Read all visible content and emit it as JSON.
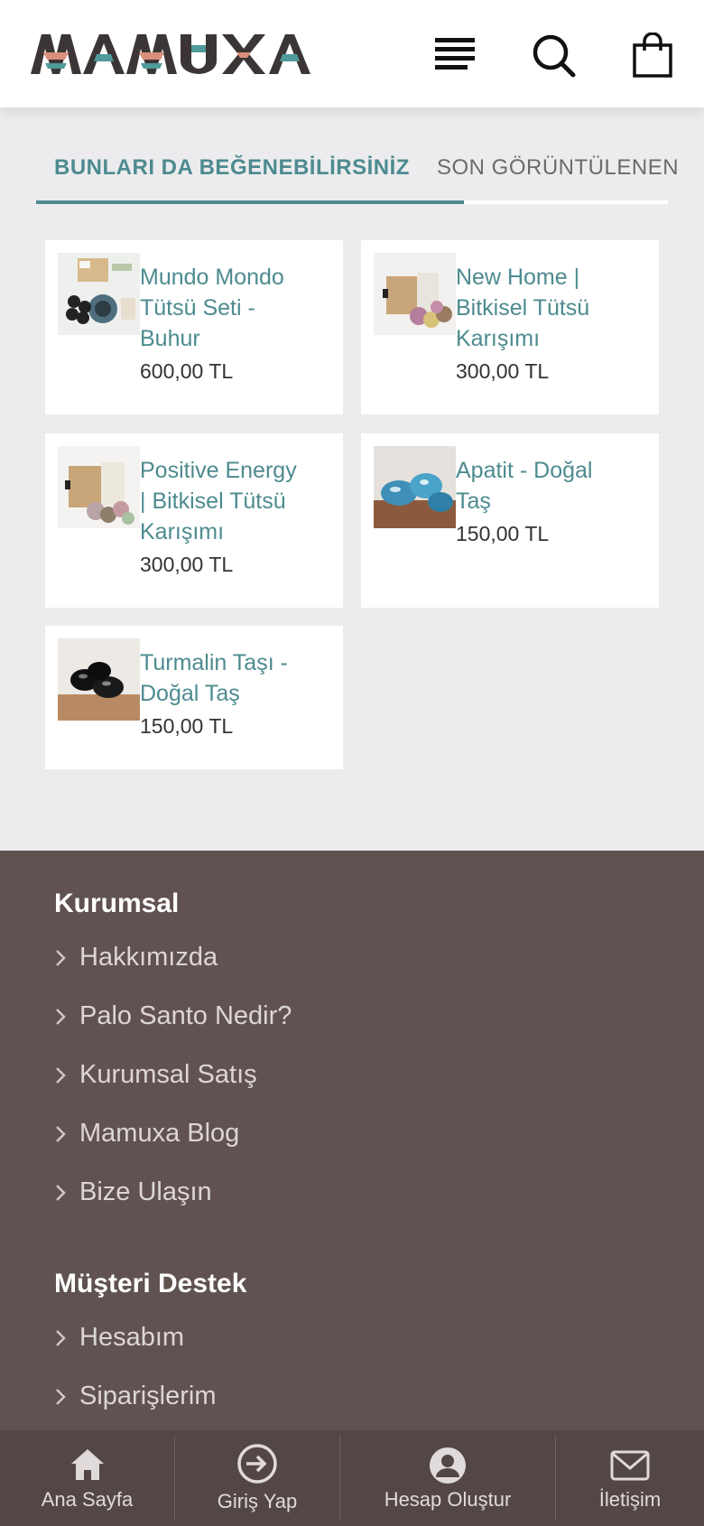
{
  "header": {
    "logo_text": "MAMUXA",
    "icons": [
      "menu-icon",
      "search-icon",
      "shopping-bag-icon"
    ]
  },
  "tabs": {
    "active_label": "BUNLARI DA BEĞENEBİLİRSİNİZ",
    "inactive_label": "SON GÖRÜNTÜLENEN"
  },
  "products": [
    {
      "name_lines": [
        "Mundo Mondo",
        "Tütsü Seti -",
        "Buhur"
      ],
      "price": "600,00 TL"
    },
    {
      "name_lines": [
        "New Home |",
        "Bitkisel Tütsü",
        "Karışımı"
      ],
      "price": "300,00 TL"
    },
    {
      "name_lines": [
        "Positive Energy",
        "| Bitkisel Tütsü",
        "Karışımı"
      ],
      "price": "300,00 TL"
    },
    {
      "name_lines": [
        "Apatit - Doğal",
        "Taş"
      ],
      "price": "150,00 TL"
    },
    {
      "name_lines": [
        "Turmalin Taşı -",
        "Doğal Taş"
      ],
      "price": "150,00 TL"
    }
  ],
  "footer": {
    "kurumsal": {
      "heading": "Kurumsal",
      "links": [
        "Hakkımızda",
        "Palo Santo Nedir?",
        "Kurumsal Satış",
        "Mamuxa Blog",
        "Bize Ulaşın"
      ]
    },
    "destek": {
      "heading": "Müşteri Destek",
      "links": [
        "Hesabım",
        "Siparişlerim"
      ]
    }
  },
  "bottom_nav": [
    {
      "label": "Ana Sayfa",
      "icon": "home-icon"
    },
    {
      "label": "Giriş Yap",
      "icon": "login-icon"
    },
    {
      "label": "Hesap Oluştur",
      "icon": "user-icon"
    },
    {
      "label": "İletişim",
      "icon": "mail-icon"
    }
  ],
  "colors": {
    "accent": "#4d8b8f",
    "footer_bg": "#615252",
    "bottom_nav_bg": "#534646",
    "page_bg": "#ececee"
  }
}
